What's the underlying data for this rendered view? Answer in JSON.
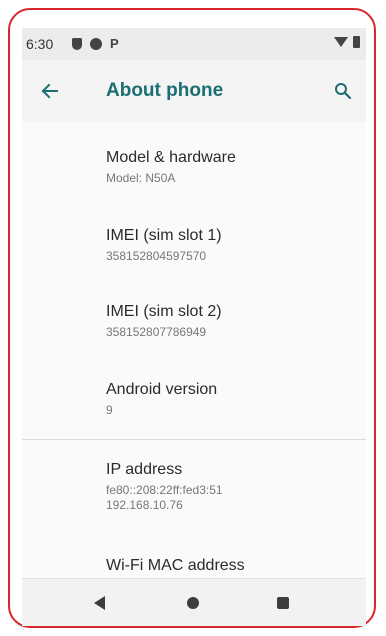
{
  "status_bar": {
    "time": "6:30",
    "notification_letter": "P"
  },
  "app_bar": {
    "title": "About phone"
  },
  "items": [
    {
      "title": "Model & hardware",
      "summary": "Model: N50A"
    },
    {
      "title": "IMEI (sim slot 1)",
      "summary": "358152804597570"
    },
    {
      "title": "IMEI (sim slot 2)",
      "summary": "358152807786949"
    },
    {
      "title": "Android version",
      "summary": "9"
    },
    {
      "title": "IP address",
      "summary_lines": [
        "fe80::208:22ff:fed3:51",
        "192.168.10.76"
      ]
    },
    {
      "title": "Wi-Fi MAC address"
    }
  ],
  "colors": {
    "accent": "#1b6e72",
    "frame_border": "#d7262e"
  },
  "icons": {
    "back": "arrow-left-icon",
    "search": "search-icon"
  }
}
